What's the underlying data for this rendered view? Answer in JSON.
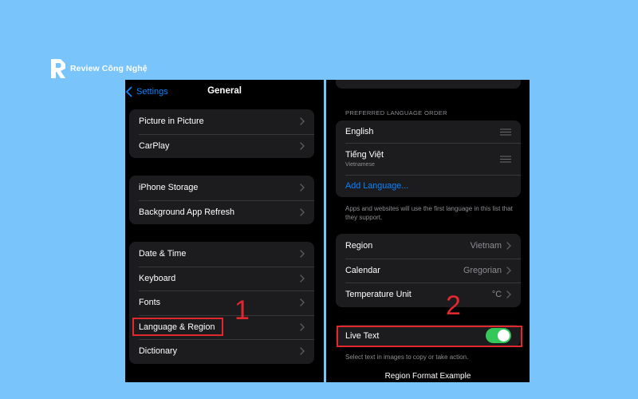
{
  "logo": {
    "text": "Review Công Nghệ"
  },
  "left_screen": {
    "back_label": "Settings",
    "title": "General",
    "group1": [
      "Picture in Picture",
      "CarPlay"
    ],
    "group2": [
      "iPhone Storage",
      "Background App Refresh"
    ],
    "group3": [
      "Date & Time",
      "Keyboard",
      "Fonts",
      "Language & Region",
      "Dictionary"
    ]
  },
  "right_screen": {
    "preferred_header": "PREFERRED LANGUAGE ORDER",
    "languages": [
      {
        "name": "English",
        "subtitle": ""
      },
      {
        "name": "Tiếng Việt",
        "subtitle": "Vietnamese"
      }
    ],
    "add_language": "Add Language...",
    "language_footnote": "Apps and websites will use the first language in this list that they support.",
    "region": {
      "label": "Region",
      "value": "Vietnam"
    },
    "calendar": {
      "label": "Calendar",
      "value": "Gregorian"
    },
    "temperature": {
      "label": "Temperature Unit",
      "value": "°C"
    },
    "live_text": {
      "label": "Live Text",
      "enabled": true
    },
    "live_text_footnote": "Select text in images to copy or take action.",
    "region_format_title": "Region Format Example"
  },
  "annotations": {
    "step1": "1",
    "step2": "2"
  },
  "colors": {
    "background": "#79c4fb",
    "accent": "#0a84ff",
    "toggle_on": "#34c759",
    "highlight": "#e0282e"
  }
}
